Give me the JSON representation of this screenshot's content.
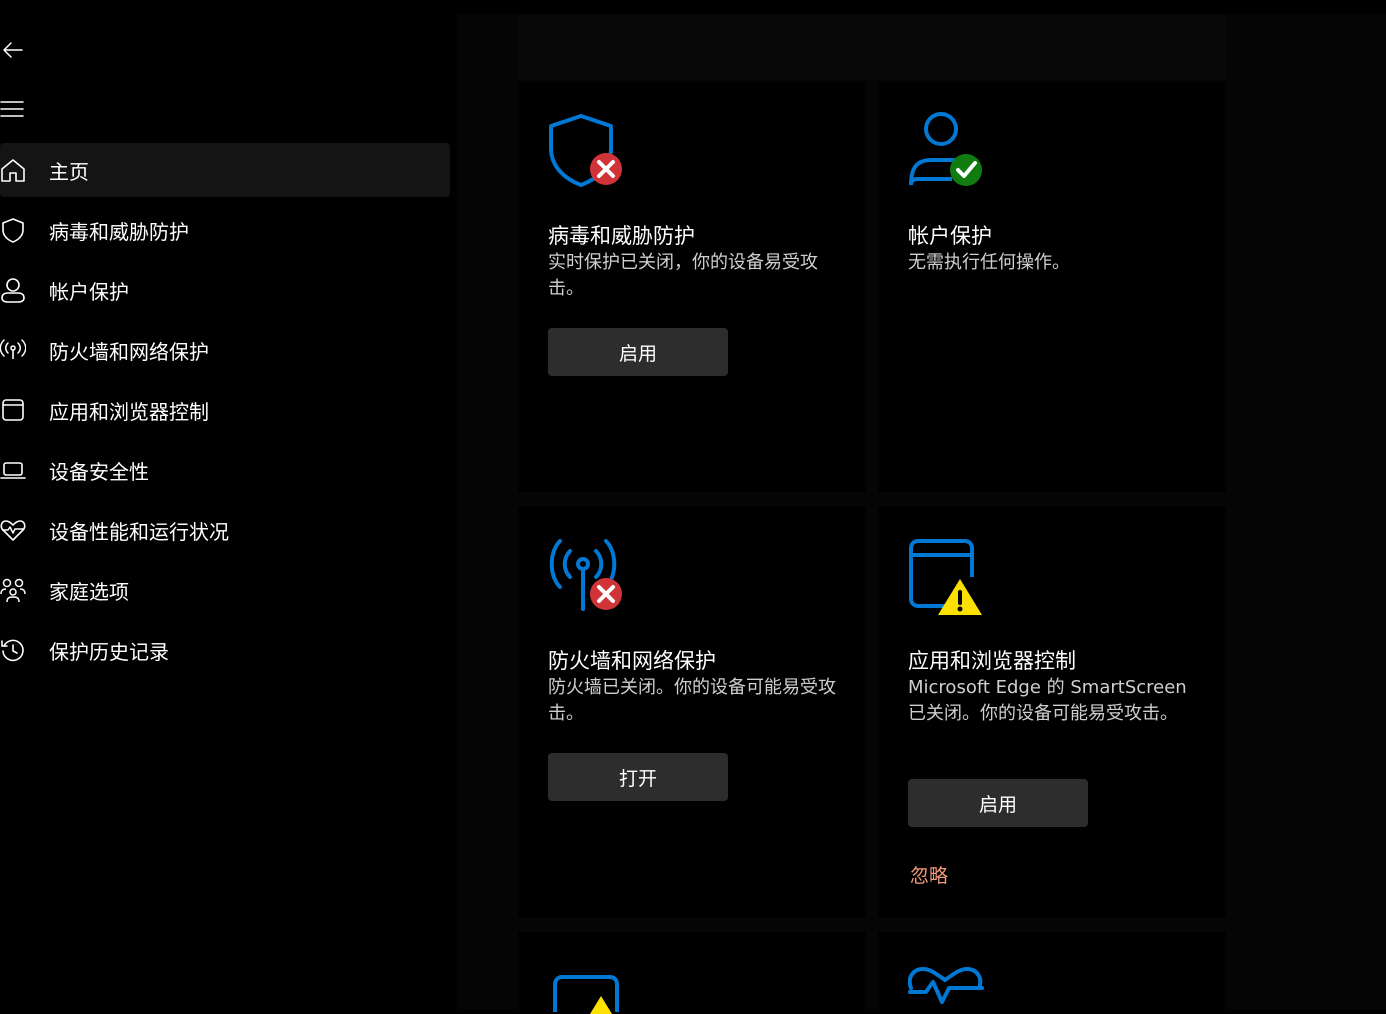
{
  "sidebar": {
    "items": [
      {
        "label": "主页",
        "icon": "home-icon",
        "active": true
      },
      {
        "label": "病毒和威胁防护",
        "icon": "shield-icon"
      },
      {
        "label": "帐户保护",
        "icon": "person-icon"
      },
      {
        "label": "防火墙和网络保护",
        "icon": "wifi-icon"
      },
      {
        "label": "应用和浏览器控制",
        "icon": "app-window-icon"
      },
      {
        "label": "设备安全性",
        "icon": "laptop-icon"
      },
      {
        "label": "设备性能和运行状况",
        "icon": "heart-icon"
      },
      {
        "label": "家庭选项",
        "icon": "family-icon"
      },
      {
        "label": "保护历史记录",
        "icon": "history-icon"
      }
    ]
  },
  "cards": {
    "virus": {
      "title": "病毒和威胁防护",
      "desc": "实时保护已关闭，你的设备易受攻击。",
      "button": "启用",
      "status": "error"
    },
    "account": {
      "title": "帐户保护",
      "desc": "无需执行任何操作。",
      "status": "ok"
    },
    "firewall": {
      "title": "防火墙和网络保护",
      "desc": "防火墙已关闭。你的设备可能易受攻击。",
      "button": "打开",
      "status": "error"
    },
    "app": {
      "title": "应用和浏览器控制",
      "desc": "Microsoft Edge 的 SmartScreen 已关闭。你的设备可能易受攻击。",
      "button": "启用",
      "link": "忽略",
      "status": "warning"
    }
  },
  "colors": {
    "accent": "#0078d4",
    "error": "#d13438",
    "ok": "#107c10",
    "warning": "#fce100",
    "link": "#f39a7a"
  }
}
